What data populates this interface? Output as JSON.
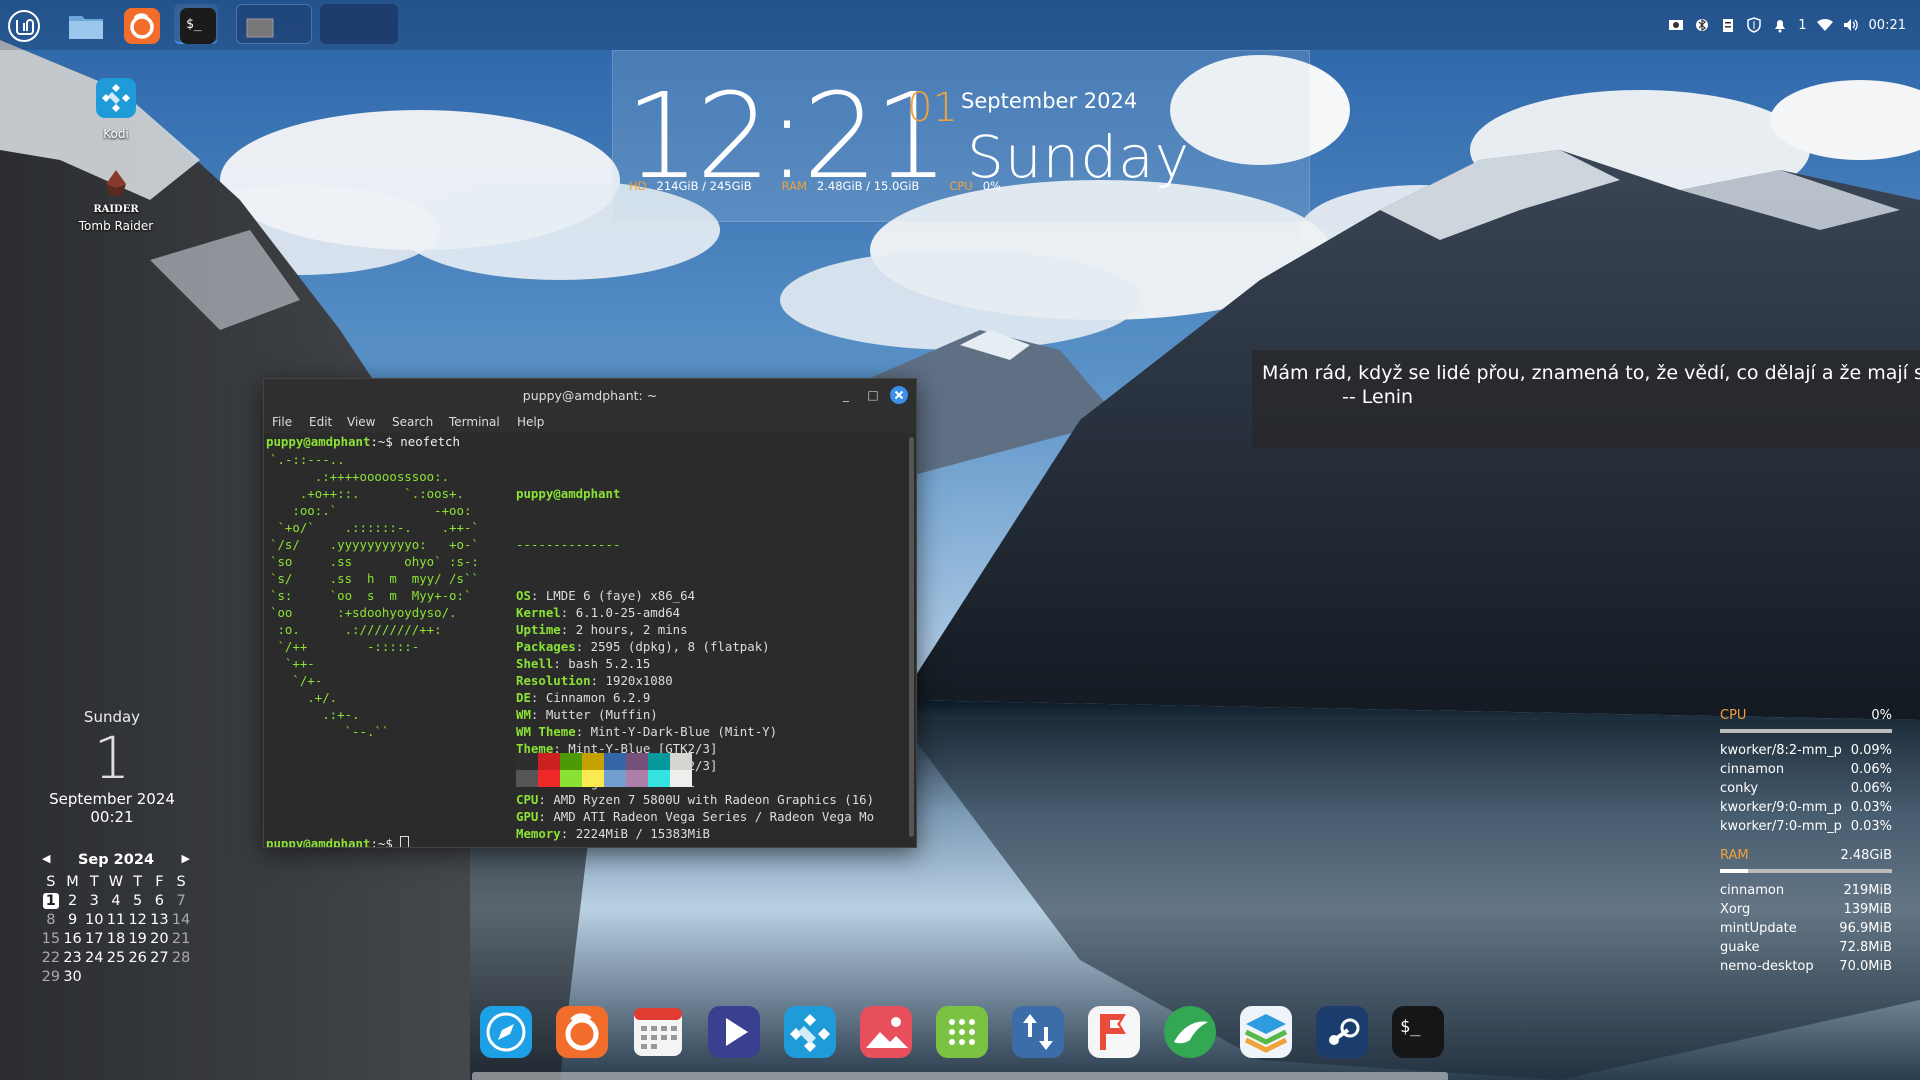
{
  "desktop": {
    "icons": [
      {
        "label": "Kodi",
        "icon": "kodi-icon"
      },
      {
        "label": "Tomb Raider",
        "badge": "RAIDER",
        "icon": "tomb-raider-icon"
      }
    ]
  },
  "top_panel": {
    "launchers": [
      {
        "name": "menu",
        "icon": "linux-mint-menu-icon"
      },
      {
        "name": "files",
        "icon": "folder-icon"
      },
      {
        "name": "firefox",
        "icon": "firefox-icon"
      },
      {
        "name": "terminal",
        "label": "$_",
        "icon": "terminal-icon"
      },
      {
        "name": "workspace-1",
        "icon": "workspace-icon"
      },
      {
        "name": "workspace-2",
        "icon": "workspace-icon"
      }
    ],
    "tray": {
      "notification_count": "1",
      "time": "00:21",
      "icons": [
        "screenshot-icon",
        "bluetooth-icon",
        "clipboard-icon",
        "shield-icon",
        "notifications-icon",
        "wifi-icon",
        "volume-icon"
      ]
    }
  },
  "clock_desklet": {
    "time": "12:21",
    "day": "01",
    "month_year": "September 2024",
    "weekday": "Sunday",
    "stats": [
      {
        "key": "HD",
        "value": "214GiB / 245GiB"
      },
      {
        "key": "RAM",
        "value": "2.48GiB / 15.0GiB"
      },
      {
        "key": "CPU",
        "value": "0%"
      }
    ]
  },
  "quote_desklet": {
    "text": "Mám rád, když se lidé přou, znamená to, že vědí, co dělají a že mají směr.",
    "author": "-- Lenin"
  },
  "terminal": {
    "title": "puppy@amdphant: ~",
    "menu": [
      "File",
      "Edit",
      "View",
      "Search",
      "Terminal",
      "Help"
    ],
    "prompt": "puppy@amdphant",
    "prompt_suffix": ":~$ ",
    "command": "neofetch",
    "logo": [
      "`.-::---..",
      "      .:++++ooooosssoo:.",
      "    .+o++::.      `.:oos+.",
      "   :oo:.`             -+oo:",
      " `+o/`    .::::::-.    .++-`",
      "`/s/    .yyyyyyyyyyo:   +o-`",
      "`so     .ss       ohyo` :s-:",
      "`s/     .ss  h  m  myy/ /s``",
      "`s:     `oo  s  m  Myy+-o:`",
      "`oo      :+sdoohyoydyso/.",
      " :o.      .:////////++:",
      " `/++        -:::::-",
      "  `++-",
      "   `/+-",
      "     .+/.",
      "       .:+-.",
      "          `--.``"
    ],
    "user_host": "puppy@amdphant",
    "separator": "--------------",
    "info": [
      {
        "key": "OS",
        "value": "LMDE 6 (faye) x86_64"
      },
      {
        "key": "Kernel",
        "value": "6.1.0-25-amd64"
      },
      {
        "key": "Uptime",
        "value": "2 hours, 2 mins"
      },
      {
        "key": "Packages",
        "value": "2595 (dpkg), 8 (flatpak)"
      },
      {
        "key": "Shell",
        "value": "bash 5.2.15"
      },
      {
        "key": "Resolution",
        "value": "1920x1080"
      },
      {
        "key": "DE",
        "value": "Cinnamon 6.2.9"
      },
      {
        "key": "WM",
        "value": "Mutter (Muffin)"
      },
      {
        "key": "WM Theme",
        "value": "Mint-Y-Dark-Blue (Mint-Y)"
      },
      {
        "key": "Theme",
        "value": "Mint-Y-Blue [GTK2/3]"
      },
      {
        "key": "Icons",
        "value": "Mint-Y-Navy [GTK2/3]"
      },
      {
        "key": "Terminal",
        "value": "gnome-terminal"
      },
      {
        "key": "CPU",
        "value": "AMD Ryzen 7 5800U with Radeon Graphics (16)"
      },
      {
        "key": "GPU",
        "value": "AMD ATI Radeon Vega Series / Radeon Vega Mo"
      },
      {
        "key": "Memory",
        "value": "2224MiB / 15383MiB"
      }
    ],
    "swatches": [
      [
        "#2e2e2e",
        "#555555"
      ],
      [
        "#cc2020",
        "#ef2929"
      ],
      [
        "#4e9a06",
        "#8ae234"
      ],
      [
        "#c4a000",
        "#fce94f"
      ],
      [
        "#3465a4",
        "#729fcf"
      ],
      [
        "#75507b",
        "#ad7fa8"
      ],
      [
        "#06989a",
        "#34e2e2"
      ],
      [
        "#d3d7cf",
        "#eeeeec"
      ]
    ]
  },
  "calendar_desklet": {
    "weekday": "Sunday",
    "day": "1",
    "month_year": "September 2024",
    "time": "00:21",
    "grid_title": "Sep 2024",
    "prev": "◀",
    "next": "▶",
    "day_headers": [
      "S",
      "M",
      "T",
      "W",
      "T",
      "F",
      "S"
    ],
    "weeks": [
      [
        "1",
        "2",
        "3",
        "4",
        "5",
        "6",
        "7"
      ],
      [
        "8",
        "9",
        "10",
        "11",
        "12",
        "13",
        "14"
      ],
      [
        "15",
        "16",
        "17",
        "18",
        "19",
        "20",
        "21"
      ],
      [
        "22",
        "23",
        "24",
        "25",
        "26",
        "27",
        "28"
      ],
      [
        "29",
        "30",
        "",
        "",
        "",
        "",
        ""
      ]
    ]
  },
  "system_monitor": {
    "cpu": {
      "label": "CPU",
      "value": "0%",
      "fraction": 0.0,
      "processes": [
        {
          "name": "kworker/8:2-mm_p",
          "value": "0.09%"
        },
        {
          "name": "cinnamon",
          "value": "0.06%"
        },
        {
          "name": "conky",
          "value": "0.06%"
        },
        {
          "name": "kworker/9:0-mm_p",
          "value": "0.03%"
        },
        {
          "name": "kworker/7:0-mm_p",
          "value": "0.03%"
        }
      ]
    },
    "ram": {
      "label": "RAM",
      "value": "2.48GiB",
      "fraction": 0.165,
      "processes": [
        {
          "name": "cinnamon",
          "value": "219MiB"
        },
        {
          "name": "Xorg",
          "value": "139MiB"
        },
        {
          "name": "mintUpdate",
          "value": "96.9MiB"
        },
        {
          "name": "guake",
          "value": "72.8MiB"
        },
        {
          "name": "nemo-desktop",
          "value": "70.0MiB"
        }
      ]
    }
  },
  "dock": {
    "items": [
      {
        "name": "web-browser",
        "icon": "compass-icon"
      },
      {
        "name": "firefox",
        "icon": "firefox-icon"
      },
      {
        "name": "calendar",
        "icon": "calendar-icon"
      },
      {
        "name": "media-player",
        "icon": "play-icon"
      },
      {
        "name": "kodi",
        "icon": "kodi-icon"
      },
      {
        "name": "image-viewer",
        "icon": "photo-icon"
      },
      {
        "name": "app-grid",
        "icon": "app-grid-icon"
      },
      {
        "name": "update-manager",
        "icon": "transfer-arrows-icon"
      },
      {
        "name": "flathub",
        "icon": "flag-icon"
      },
      {
        "name": "mint-install",
        "icon": "leaf-icon"
      },
      {
        "name": "layers",
        "icon": "layers-icon"
      },
      {
        "name": "steam",
        "icon": "steam-icon"
      },
      {
        "name": "terminal",
        "label": "$_",
        "icon": "terminal-icon"
      }
    ]
  }
}
